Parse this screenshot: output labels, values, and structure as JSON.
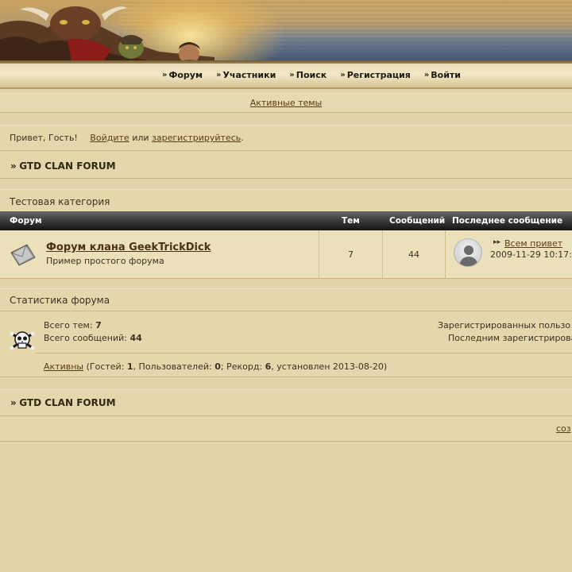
{
  "nav": {
    "items": [
      {
        "label": "Форум"
      },
      {
        "label": "Участники"
      },
      {
        "label": "Поиск"
      },
      {
        "label": "Регистрация"
      },
      {
        "label": "Войти"
      }
    ]
  },
  "active_topics_link": "Активные темы",
  "guest": {
    "greeting": "Привет, Гость!",
    "login_link": "Войдите",
    "or_text": "или",
    "register_link": "зарегистрируйтесь",
    "period": "."
  },
  "breadcrumb": {
    "prefix": "»",
    "title": "GTD CLAN FORUM"
  },
  "category": {
    "title": "Тестовая категория",
    "columns": {
      "forum": "Форум",
      "topics": "Тем",
      "posts": "Сообщений",
      "last_post": "Последнее сообщение"
    },
    "forums": [
      {
        "name": "Форум клана GeekTrickDick",
        "description": "Пример простого форума",
        "topics": "7",
        "posts": "44",
        "last_post_title": "Всем привет",
        "last_post_date": "2009-11-29 10:17:"
      }
    ]
  },
  "stats": {
    "title": "Статистика форума",
    "total_topics_label": "Всего тем:",
    "total_topics": "7",
    "total_posts_label": "Всего сообщений:",
    "total_posts": "44",
    "registered_users_label": "Зарегистрированных пользо",
    "last_registered_label": "Последним зарегистрирова",
    "active_link": "Активны",
    "guests_label": "(Гостей:",
    "guests": "1",
    "users_label": ", Пользователей:",
    "users": "0",
    "record_label": "; Рекорд:",
    "record": "6",
    "record_date": ", установлен 2013-08-20)"
  },
  "footer": {
    "prefix": "»",
    "title": "GTD CLAN FORUM",
    "right_link": "соз"
  }
}
